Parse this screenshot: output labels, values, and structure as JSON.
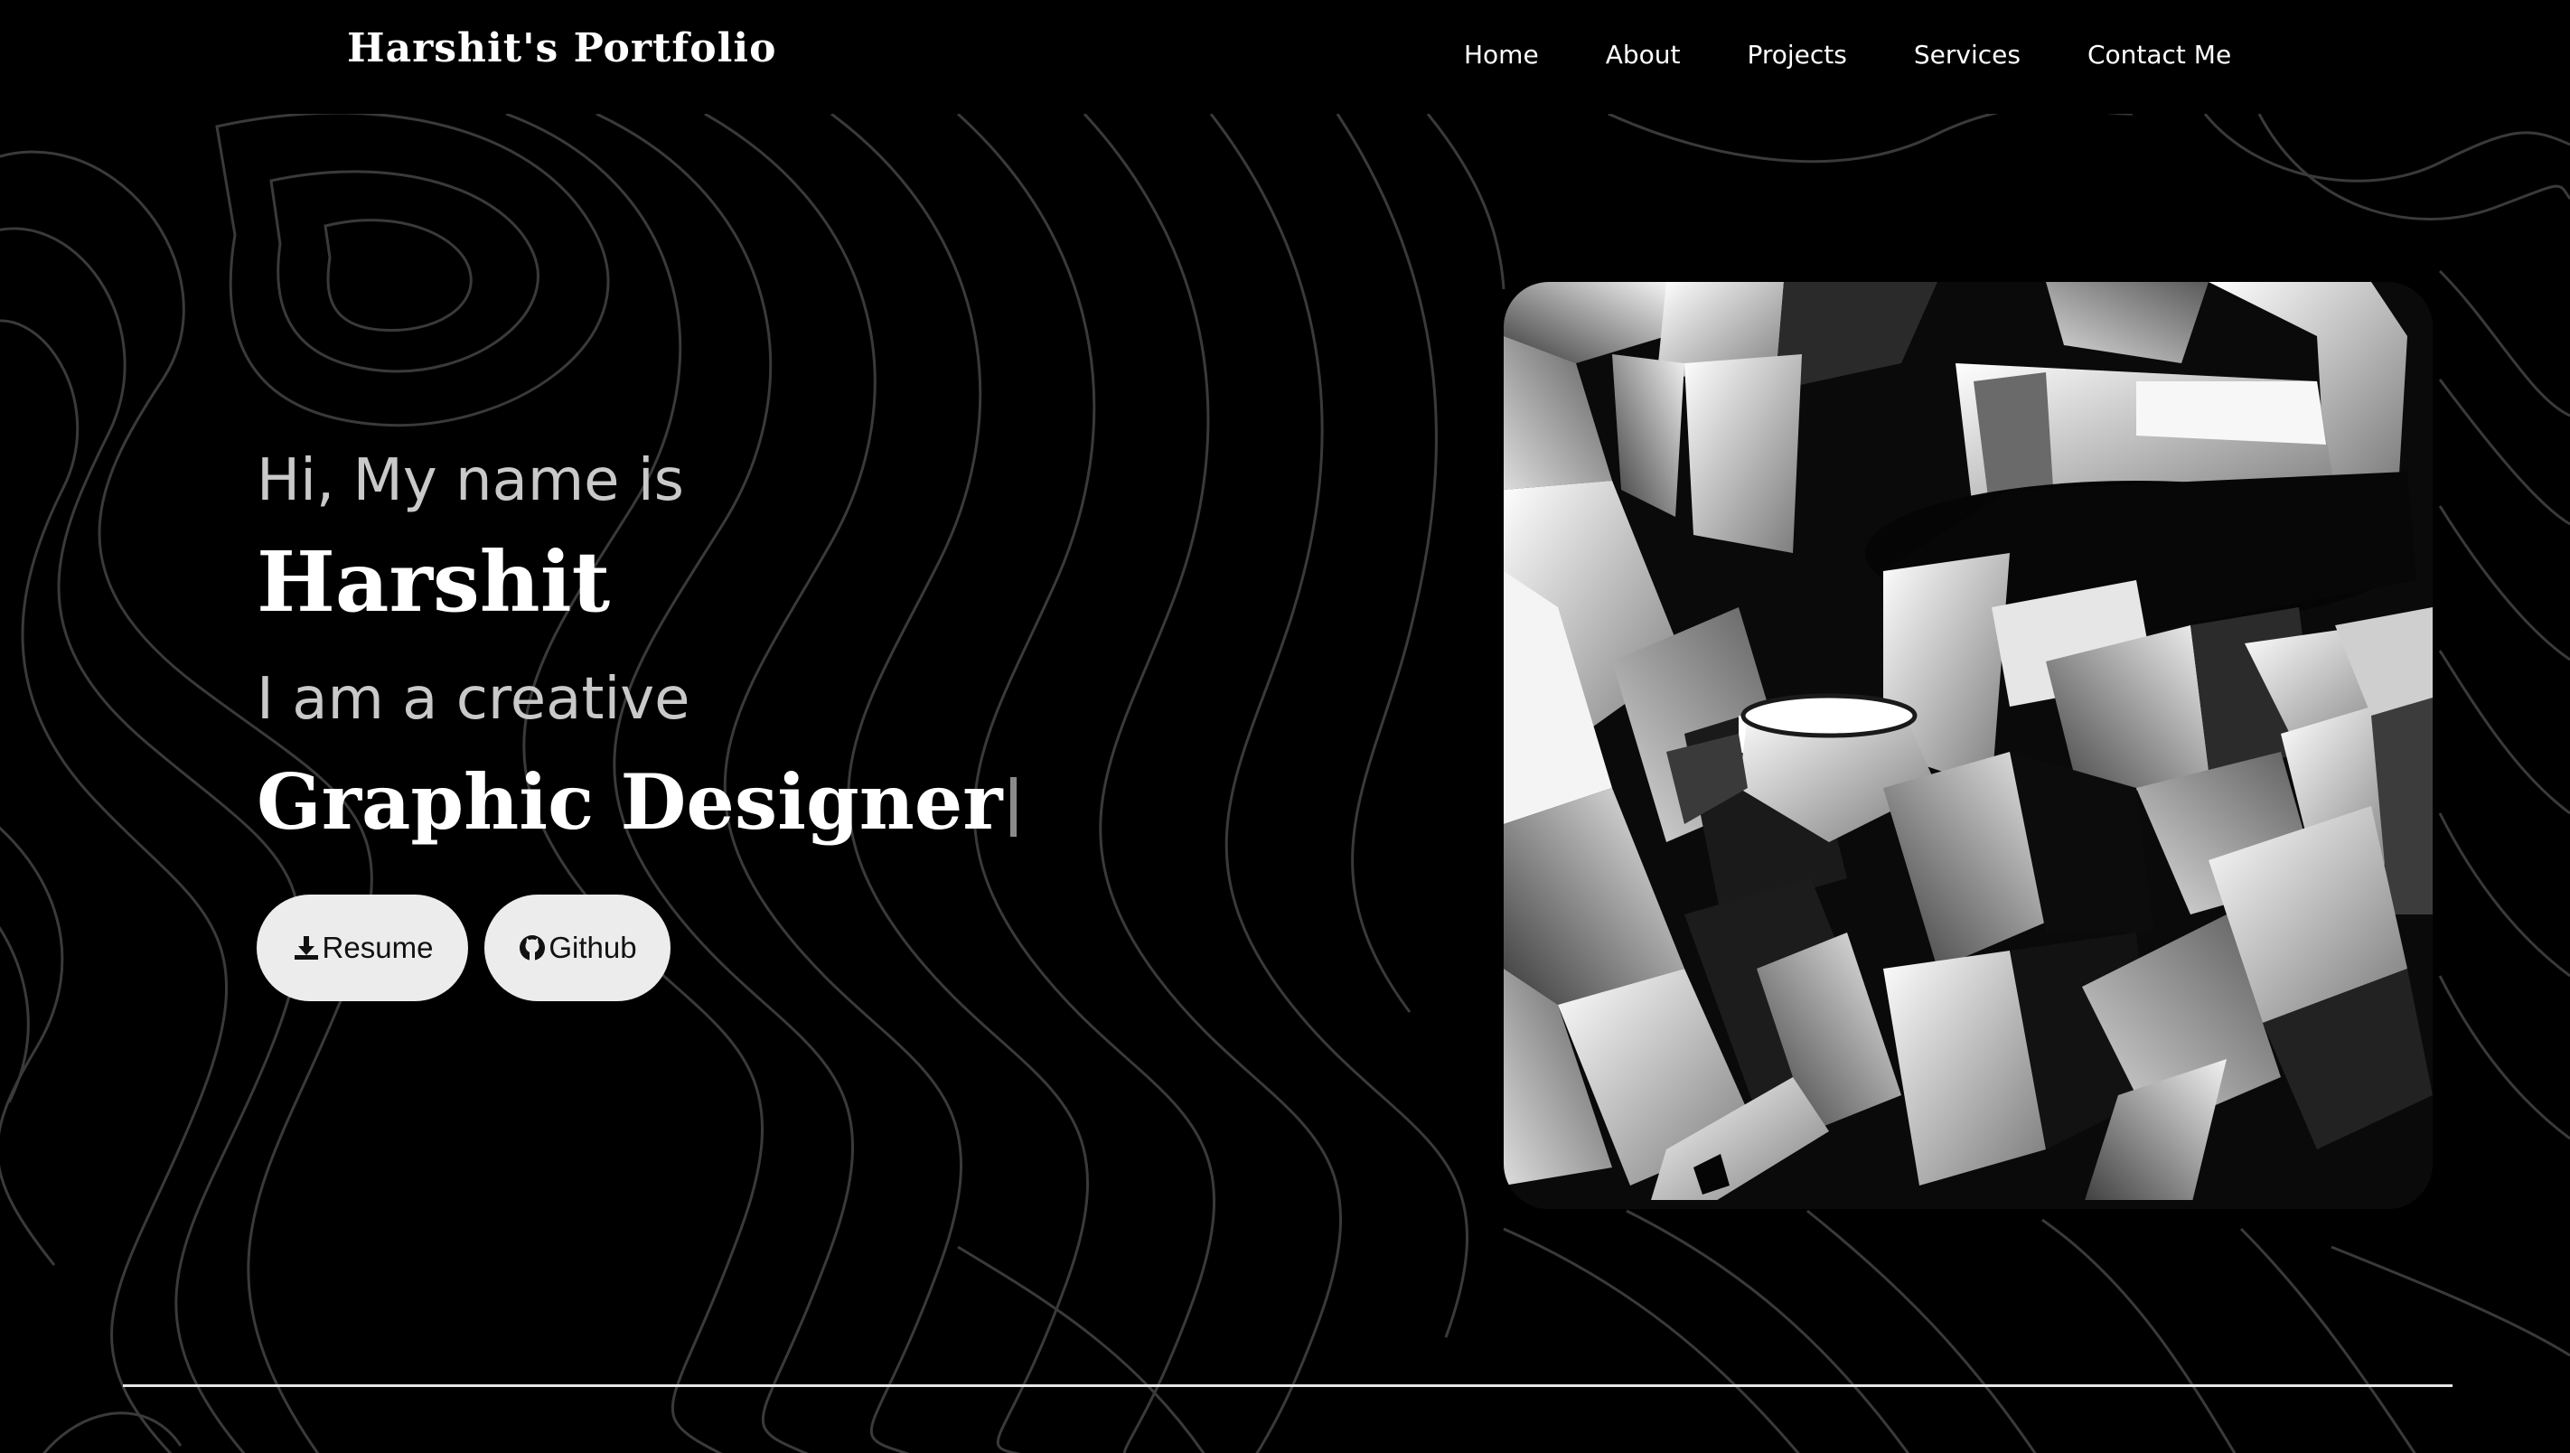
{
  "navbar": {
    "brand": "Harshit's Portfolio",
    "links": [
      {
        "label": "Home"
      },
      {
        "label": "About"
      },
      {
        "label": "Projects"
      },
      {
        "label": "Services"
      },
      {
        "label": "Contact Me"
      }
    ]
  },
  "hero": {
    "greeting": "Hi, My name is",
    "name": "Harshit",
    "subline": "I am a creative",
    "role": "Graphic Designer",
    "buttons": {
      "resume": {
        "label": "Resume",
        "icon": "download-icon"
      },
      "github": {
        "label": "Github",
        "icon": "github-icon"
      }
    }
  },
  "colors": {
    "background": "#000000",
    "text_primary": "#ffffff",
    "text_muted": "#c9c9c9",
    "button_bg": "#ececec",
    "contour_lines": "#3a3a3a"
  }
}
